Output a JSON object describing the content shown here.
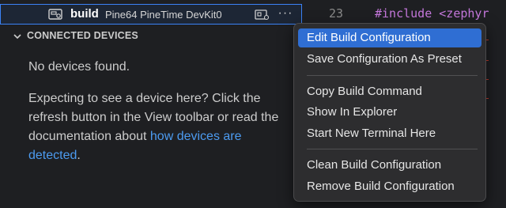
{
  "build_row": {
    "label": "build",
    "board": "Pine64 PineTime DevKit0",
    "more": "···"
  },
  "section": {
    "title": "CONNECTED DEVICES"
  },
  "content": {
    "no_devices": "No devices found.",
    "help_prefix": "Expecting to see a device here? Click the refresh button in the View toolbar or read the documentation about ",
    "help_link": "how devices are detected",
    "help_suffix": "."
  },
  "editor": {
    "line_number": "23",
    "code": "#include <zephyr"
  },
  "menu": {
    "items": [
      {
        "label": "Edit Build Configuration",
        "active": true
      },
      {
        "label": "Save Configuration As Preset",
        "active": false
      },
      {
        "label": "Copy Build Command",
        "active": false
      },
      {
        "label": "Show In Explorer",
        "active": false
      },
      {
        "label": "Start New Terminal Here",
        "active": false
      },
      {
        "label": "Clean Build Configuration",
        "active": false
      },
      {
        "label": "Remove Build Configuration",
        "active": false
      }
    ]
  },
  "colors": {
    "accent": "#2f6ed3",
    "link": "#4c9bf0",
    "selection_border": "#3b82f6"
  }
}
